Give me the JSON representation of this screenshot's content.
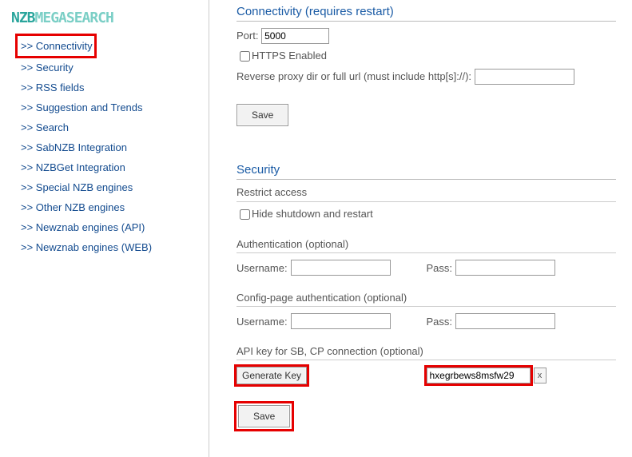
{
  "logo": {
    "part1": "NZB",
    "part2": "MEGASEARCH"
  },
  "sidebar": {
    "items": [
      {
        "label": "Connectivity",
        "highlighted": true
      },
      {
        "label": "Security"
      },
      {
        "label": "RSS fields"
      },
      {
        "label": "Suggestion and Trends"
      },
      {
        "label": "Search"
      },
      {
        "label": "SabNZB Integration"
      },
      {
        "label": "NZBGet Integration"
      },
      {
        "label": "Special NZB engines"
      },
      {
        "label": "Other NZB engines"
      },
      {
        "label": "Newznab engines (API)"
      },
      {
        "label": "Newznab engines (WEB)"
      }
    ],
    "prefix": ">> "
  },
  "connectivity": {
    "heading": "Connectivity (requires restart)",
    "port_label": "Port:",
    "port_value": "5000",
    "https_label": "HTTPS Enabled",
    "reverse_label": "Reverse proxy dir or full url (must include http[s]://):",
    "reverse_value": "",
    "save_label": "Save"
  },
  "security": {
    "heading": "Security",
    "restrict_label": "Restrict access",
    "hide_label": "Hide shutdown and restart",
    "auth_heading": "Authentication (optional)",
    "username_label": "Username:",
    "username_value": "",
    "pass_label": "Pass:",
    "pass_value": "",
    "cfg_auth_heading": "Config-page authentication (optional)",
    "cfg_username_value": "",
    "cfg_pass_value": "",
    "api_heading": "API key for SB, CP connection (optional)",
    "gen_key_label": "Generate Key",
    "api_value": "hxegrbews8msfw29",
    "clear_x": "x",
    "save_label": "Save"
  }
}
